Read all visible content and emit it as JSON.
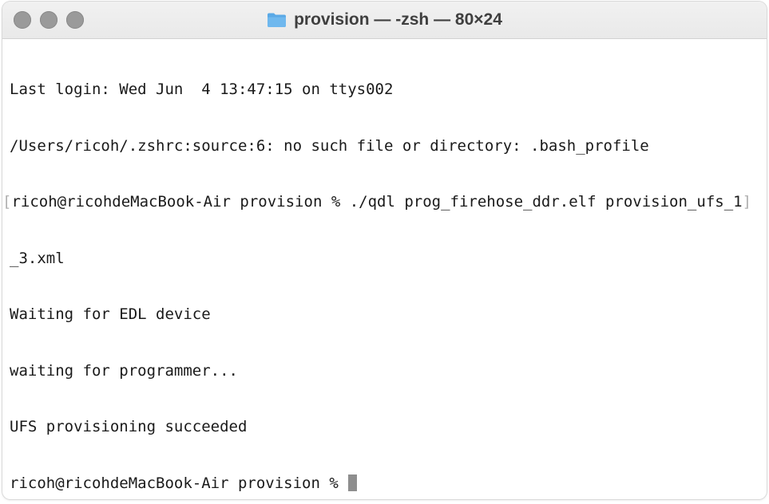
{
  "window": {
    "title": "provision — -zsh — 80×24",
    "folder_icon": "folder-icon",
    "folder_color": "#5aa9e6",
    "traffic_lights": [
      "close-button",
      "minimize-button",
      "zoom-button"
    ]
  },
  "terminal": {
    "lines": [
      "Last login: Wed Jun  4 13:47:15 on ttys002",
      "/Users/ricoh/.zshrc:source:6: no such file or directory: .bash_profile"
    ],
    "command_line": {
      "bracket_open": "[",
      "text": "ricoh@ricohdeMacBook-Air provision % ./qdl prog_firehose_ddr.elf provision_ufs_1",
      "bracket_close": "]"
    },
    "output": [
      "_3.xml",
      "Waiting for EDL device",
      "waiting for programmer...",
      "UFS provisioning succeeded"
    ],
    "prompt": "ricoh@ricohdeMacBook-Air provision % "
  }
}
